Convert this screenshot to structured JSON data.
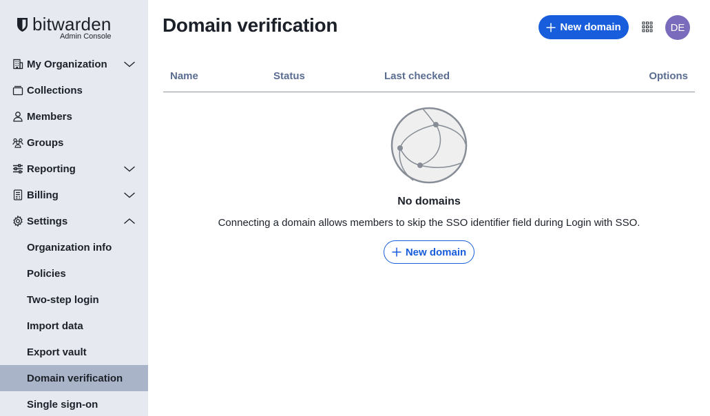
{
  "brand": {
    "name": "bitwarden",
    "subtitle": "Admin Console",
    "logo_icon": "shield-icon"
  },
  "sidebar": {
    "items": [
      {
        "label": "My Organization",
        "icon": "building-icon",
        "chevron": "down"
      },
      {
        "label": "Collections",
        "icon": "collection-icon"
      },
      {
        "label": "Members",
        "icon": "user-icon"
      },
      {
        "label": "Groups",
        "icon": "users-icon"
      },
      {
        "label": "Reporting",
        "icon": "sliders-icon",
        "chevron": "down"
      },
      {
        "label": "Billing",
        "icon": "billing-icon",
        "chevron": "down"
      },
      {
        "label": "Settings",
        "icon": "gear-icon",
        "chevron": "up"
      }
    ],
    "settings_items": [
      {
        "label": "Organization info"
      },
      {
        "label": "Policies"
      },
      {
        "label": "Two-step login"
      },
      {
        "label": "Import data"
      },
      {
        "label": "Export vault"
      },
      {
        "label": "Domain verification",
        "active": true
      },
      {
        "label": "Single sign-on"
      }
    ]
  },
  "header": {
    "title": "Domain verification",
    "new_domain_label": "New domain",
    "avatar_initials": "DE"
  },
  "table": {
    "columns": {
      "name": "Name",
      "status": "Status",
      "last_checked": "Last checked",
      "options": "Options"
    }
  },
  "empty_state": {
    "title": "No domains",
    "description": "Connecting a domain allows members to skip the SSO identifier field during Login with SSO.",
    "button_label": "New domain"
  },
  "colors": {
    "accent": "#175ddc",
    "sidebar_bg": "#e6e9ef",
    "active_item_bg": "#aab4c8",
    "avatar_bg": "#7a6bbd",
    "table_header_text": "#5a6d91"
  }
}
